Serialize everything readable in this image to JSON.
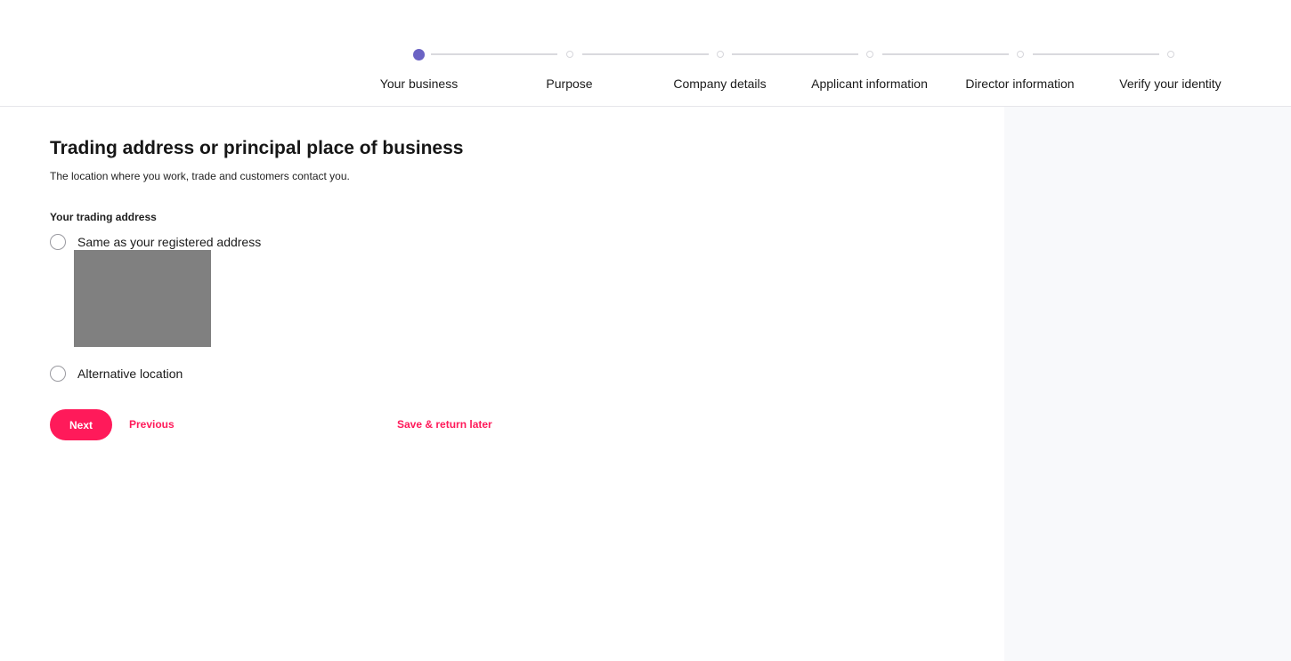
{
  "stepper": {
    "steps": [
      {
        "label": "Your business",
        "active": true
      },
      {
        "label": "Purpose",
        "active": false
      },
      {
        "label": "Company details",
        "active": false
      },
      {
        "label": "Applicant information",
        "active": false
      },
      {
        "label": "Director information",
        "active": false
      },
      {
        "label": "Verify your identity",
        "active": false
      }
    ],
    "active_color": "#6b63c4"
  },
  "form": {
    "title": "Trading address or principal place of business",
    "subtitle": "The location where you work, trade and customers contact you.",
    "field_label": "Your trading address",
    "options": [
      {
        "label": "Same as your registered address",
        "selected": false
      },
      {
        "label": "Alternative location",
        "selected": false
      }
    ]
  },
  "actions": {
    "next_label": "Next",
    "previous_label": "Previous",
    "save_label": "Save & return later",
    "accent_color": "#ff1a5a"
  }
}
